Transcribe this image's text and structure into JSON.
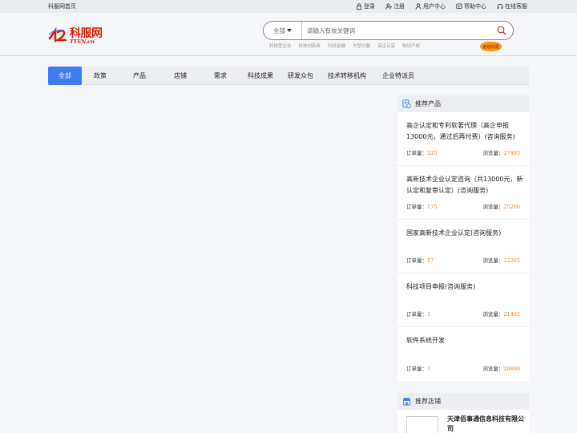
{
  "topbar": {
    "home": "科服网首页",
    "links": [
      {
        "label": "登录",
        "icon": "lock-icon"
      },
      {
        "label": "注册",
        "icon": "user-plus-icon"
      },
      {
        "label": "用户中心",
        "icon": "user-icon"
      },
      {
        "label": "帮助中心",
        "icon": "help-icon"
      },
      {
        "label": "在线客服",
        "icon": "headset-icon"
      }
    ]
  },
  "header": {
    "logo_text": "科服网",
    "logo_sub": "TTEN.cn",
    "search": {
      "scope": "全部",
      "placeholder": "请输入有效关键词"
    },
    "hot_words": [
      "科技型企业",
      "科技创新券",
      "科技金融",
      "大型仪器",
      "高企认定",
      "知识产权"
    ],
    "badge": "走进科服"
  },
  "nav": {
    "tabs": [
      "全部",
      "政策",
      "产品",
      "店铺",
      "需求",
      "科技成果",
      "研发众包",
      "技术转移机构",
      "企业特派员"
    ],
    "active": "全部"
  },
  "recommended_products": {
    "title": "推荐产品",
    "order_label": "订单量：",
    "view_label": "浏览量：",
    "items": [
      {
        "title": "高企认定和专利软著代理（高企申报13000元，通过后再付费）(咨询服务)",
        "orders": "225",
        "views": "27495"
      },
      {
        "title": "高新技术企业认定咨询（共13000元，新认定和复审认定）(咨询服务)",
        "orders": "175",
        "views": "25200"
      },
      {
        "title": "国家高新技术企业认定(咨询服务)",
        "orders": "17",
        "views": "22265"
      },
      {
        "title": "科技项目申报(咨询服务)",
        "orders": "1",
        "views": "21402"
      },
      {
        "title": "软件系统开发",
        "orders": "1",
        "views": "20690"
      }
    ]
  },
  "recommended_shops": {
    "title": "推荐店铺",
    "items": [
      {
        "name": "天津佰事通信息科技有限公司"
      }
    ]
  },
  "colors": {
    "accent": "#3e7bf0",
    "brand": "#d81e06",
    "number": "#e67e22"
  }
}
